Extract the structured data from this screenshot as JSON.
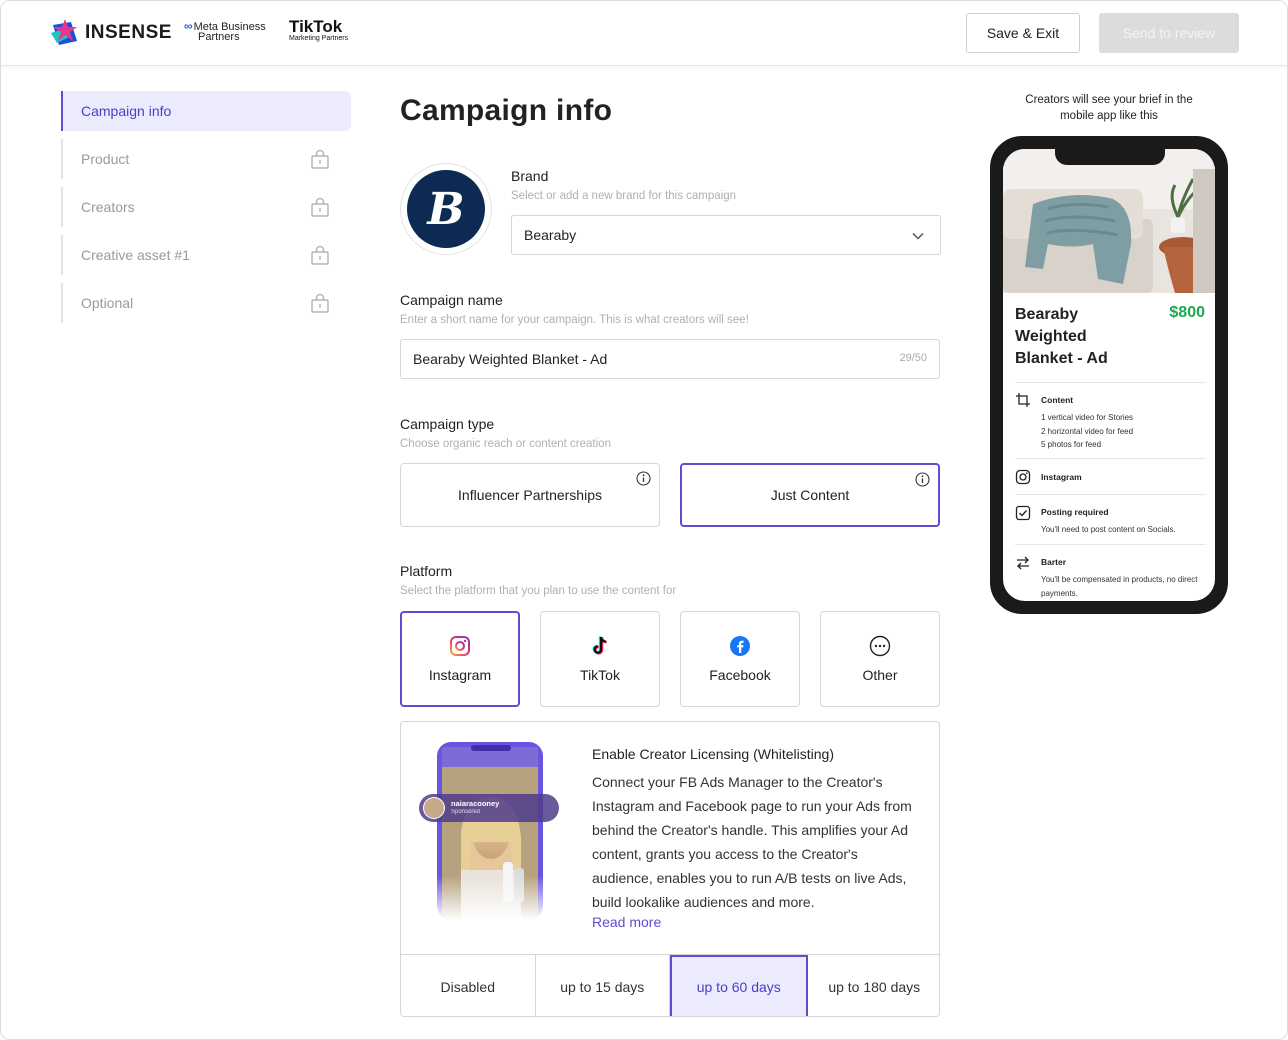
{
  "header": {
    "logo_text": "INSENSE",
    "meta_line1": "Meta Business",
    "meta_line2": "Partners",
    "tiktok_line1": "TikTok",
    "tiktok_line2": "Marketing Partners",
    "save_exit_label": "Save & Exit",
    "send_review_label": "Send to review"
  },
  "sidebar": {
    "items": [
      {
        "label": "Campaign info",
        "active": true,
        "locked": false
      },
      {
        "label": "Product",
        "locked": true
      },
      {
        "label": "Creators",
        "locked": true
      },
      {
        "label": "Creative asset #1",
        "locked": true
      },
      {
        "label": "Optional",
        "locked": true
      }
    ]
  },
  "main": {
    "title": "Campaign info",
    "brand": {
      "label": "Brand",
      "hint": "Select or add a new brand for this campaign",
      "value": "Bearaby",
      "logo_letter": "B"
    },
    "campaign_name": {
      "label": "Campaign name",
      "hint": "Enter a short name for your campaign. This is what creators will see!",
      "value": "Bearaby Weighted Blanket - Ad",
      "counter": "29/50"
    },
    "campaign_type": {
      "label": "Campaign type",
      "hint": "Choose organic reach or content creation",
      "options": [
        "Influencer Partnerships",
        "Just Content"
      ],
      "selected": "Just Content"
    },
    "platform": {
      "label": "Platform",
      "hint": "Select the platform that you plan to use the content for",
      "options": [
        "Instagram",
        "TikTok",
        "Facebook",
        "Other"
      ],
      "selected": "Instagram"
    },
    "licensing": {
      "title": "Enable Creator Licensing (Whitelisting)",
      "body": "Connect your FB Ads Manager to the Creator's Instagram and Facebook page to run your Ads from behind the Creator's handle. This amplifies your Ad content, grants you access to the Creator's audience, enables you to run A/B tests on live Ads, build lookalike audiences and more.",
      "read_more": "Read more",
      "creator_handle": "naiaracooney",
      "creator_sub": "Sponsored",
      "options": [
        "Disabled",
        "up to 15 days",
        "up to 60 days",
        "up to 180 days"
      ],
      "selected": "up to 60 days"
    }
  },
  "preview": {
    "caption": "Creators will see your brief in the mobile app like this",
    "title": "Bearaby Weighted Blanket - Ad",
    "price": "$800",
    "content_label": "Content",
    "content_lines": [
      "1 vertical video for Stories",
      "2 horizontal video for feed",
      "5 photos for feed"
    ],
    "platform_label": "Instagram",
    "posting_label": "Posting required",
    "posting_text": "You'll need to post content on Socials.",
    "barter_label": "Barter",
    "barter_text": "You'll be compensated in products, no direct payments."
  },
  "colors": {
    "accent": "#5b4fcf",
    "accent_bg": "#ecebfd",
    "price_green": "#1fa84f",
    "brand_navy": "#0d2b52"
  }
}
